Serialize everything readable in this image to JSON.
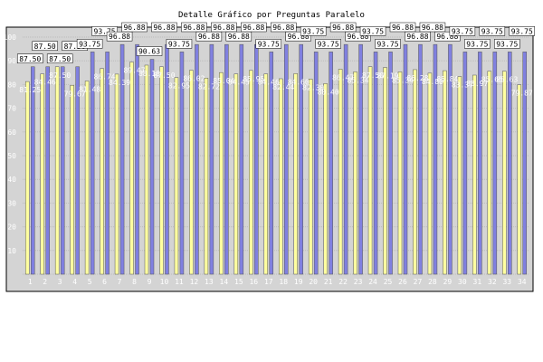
{
  "chart_data": {
    "type": "bar",
    "title": "Detalle Gráfico por Preguntas Paralelo",
    "xlabel": "",
    "ylabel": "",
    "ylim": [
      0,
      100
    ],
    "grid": true,
    "legend": "none",
    "categories": [
      "1",
      "2",
      "3",
      "4",
      "5",
      "6",
      "7",
      "8",
      "9",
      "10",
      "11",
      "12",
      "13",
      "14",
      "15",
      "16",
      "17",
      "18",
      "19",
      "20",
      "21",
      "22",
      "23",
      "24",
      "25",
      "26",
      "27",
      "28",
      "29",
      "30",
      "31",
      "32",
      "33",
      "34"
    ],
    "series": [
      {
        "color": "#8080e0",
        "values": [
          87.5,
          87.5,
          87.5,
          87.5,
          93.75,
          93.75,
          96.88,
          96.88,
          90.63,
          96.88,
          93.75,
          96.88,
          96.88,
          96.88,
          96.88,
          96.88,
          93.75,
          96.88,
          96.88,
          93.75,
          93.75,
          96.88,
          96.88,
          93.75,
          93.75,
          96.88,
          96.88,
          96.88,
          96.88,
          93.75,
          93.75,
          93.75,
          93.75,
          93.75
        ],
        "labels": [
          "87.50",
          "87.50",
          "87.50",
          "87.50",
          "93.75",
          "93.75",
          "96.88",
          "96.88",
          "90.63",
          "96.88",
          "93.75",
          "96.88",
          "96.88",
          "96.88",
          "96.88",
          "96.88",
          "93.75",
          "96.88",
          "96.88",
          "93.75",
          "93.75",
          "96.88",
          "96.88",
          "93.75",
          "93.75",
          "96.88",
          "96.88",
          "96.88",
          "96.88",
          "93.75",
          "93.75",
          "93.75",
          "93.75",
          "93.75"
        ]
      },
      {
        "color": "#ffffa0",
        "values": [
          81.25,
          84.46,
          87.5,
          79.67,
          81.48,
          86.74,
          84.39,
          89.47,
          88.18,
          87.5,
          82.95,
          86.02,
          82.72,
          85.04,
          84.45,
          85.95,
          84.46,
          82.44,
          84.6,
          82.3,
          80.4,
          86.47,
          85.34,
          87.5,
          87.19,
          85.34,
          86.28,
          84.8,
          85.84,
          83.37,
          83.97,
          85.65,
          85.63,
          79.87
        ],
        "labels": [
          "81.25",
          "84.46",
          "87.50",
          "79.67",
          "81.48",
          "86.74",
          "84.39",
          "89.47",
          "88.18",
          "87.50",
          "82.95",
          "86.02",
          "82.72",
          "85.04",
          "84.45",
          "85.95",
          "84.46",
          "82.44",
          "84.60",
          "82.30",
          "80.40",
          "86.47",
          "85.34",
          "87.50",
          "87.19",
          "85.34",
          "86.28",
          "84.80",
          "85.84",
          "83.37",
          "83.97",
          "85.65",
          "85.63",
          "79.87"
        ]
      }
    ]
  }
}
